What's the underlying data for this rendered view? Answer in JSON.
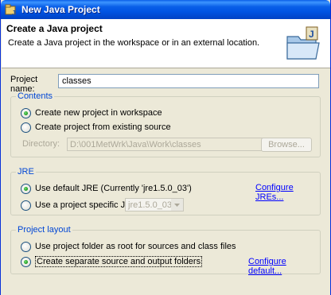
{
  "window": {
    "title": "New Java Project"
  },
  "banner": {
    "title": "Create a Java project",
    "description": "Create a Java project in the workspace or in an external location."
  },
  "project_name": {
    "label": "Project name:",
    "value": "classes"
  },
  "contents": {
    "legend": "Contents",
    "option_new": "Create new project in workspace",
    "option_existing": "Create project from existing source",
    "directory_label": "Directory:",
    "directory_value": "D:\\001MetWrk\\Java\\Work\\classes",
    "browse_label": "Browse..."
  },
  "jre": {
    "legend": "JRE",
    "option_default": "Use default JRE (Currently 'jre1.5.0_03')",
    "configure_link": "Configure JREs...",
    "option_specific": "Use a project specific JRE:",
    "specific_value": "jre1.5.0_03"
  },
  "layout": {
    "legend": "Project layout",
    "option_root": "Use project folder as root for sources and class files",
    "option_separate": "Create separate source and output folders",
    "configure_link": "Configure default..."
  },
  "colors": {
    "legend": "#0046d5",
    "link": "#0000ff",
    "title_bar": "#0054e3"
  },
  "icons": {
    "window": "java-project-icon",
    "banner": "folder-wizard-icon",
    "dropdown": "chevron-down-icon"
  }
}
